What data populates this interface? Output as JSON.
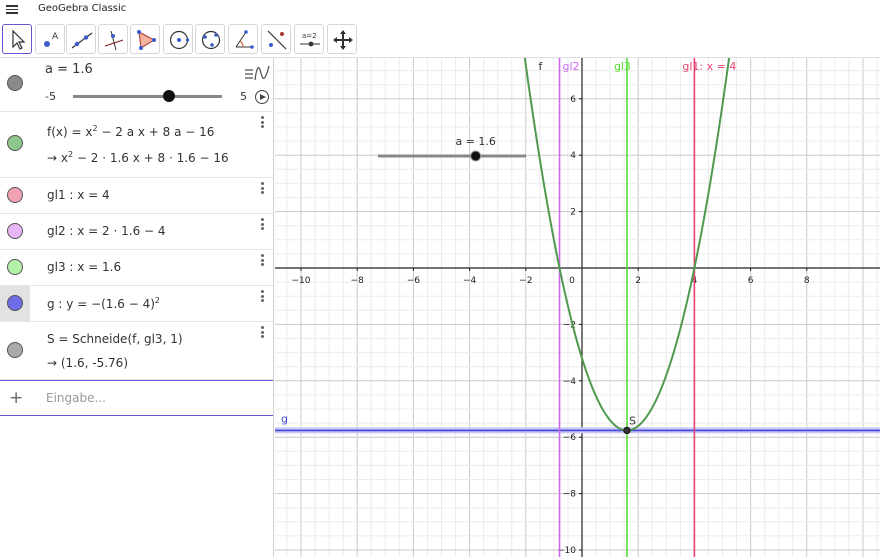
{
  "app": {
    "title": "GeoGebra Classic"
  },
  "toolbar": {
    "tools": [
      {
        "name": "move-tool-button",
        "icon": "arrow-icon",
        "active": true
      },
      {
        "name": "point-tool-button",
        "icon": "point-icon"
      },
      {
        "name": "line-tool-button",
        "icon": "line-icon"
      },
      {
        "name": "perpendicular-line-tool-button",
        "icon": "perpendicular-icon"
      },
      {
        "name": "polygon-tool-button",
        "icon": "polygon-icon"
      },
      {
        "name": "circle-tool-button",
        "icon": "circle-center-icon"
      },
      {
        "name": "circle-three-points-tool-button",
        "icon": "circle-three-points-icon"
      },
      {
        "name": "angle-tool-button",
        "icon": "angle-icon"
      },
      {
        "name": "reflect-tool-button",
        "icon": "reflect-icon"
      },
      {
        "name": "slider-tool-button",
        "icon": "slider-icon",
        "label": "a=2"
      },
      {
        "name": "move-graphics-tool-button",
        "icon": "move-graphics-icon"
      }
    ]
  },
  "algebra": {
    "slider": {
      "label": "a = 1.6",
      "min": "-5",
      "max": "5",
      "value": 1.6
    },
    "f": {
      "def": "f(x) = x",
      "def_exp": "2",
      "def_rest": " − 2 a x + 8 a − 16",
      "arrow": "→",
      "val": "  x",
      "val_exp": "2",
      "val_rest": " − 2 · 1.6 x + 8 · 1.6 − 16",
      "color": "#4f9a4f"
    },
    "gl1": {
      "def": "gl1 : x = 4",
      "color": "#f0728a"
    },
    "gl2": {
      "def": "gl2 : x = 2 · 1.6 − 4",
      "color": "#d98ef2"
    },
    "gl3": {
      "def": "gl3 : x = 1.6",
      "color": "#8ae67a"
    },
    "g": {
      "def": "g : y = −(1.6 − 4)",
      "def_exp": "2",
      "color": "#6666dd"
    },
    "S": {
      "def": "S = Schneide(f, gl3, 1)",
      "arrow": "→",
      "val": "  (1.6, -5.76)",
      "color": "#999999"
    },
    "input": {
      "placeholder": "Eingabe..."
    }
  },
  "graphics": {
    "x_ticks": [
      "−10",
      "−8",
      "−6",
      "−4",
      "−2",
      "0",
      "2",
      "4",
      "6",
      "8"
    ],
    "y_ticks": [
      "6",
      "4",
      "2",
      "−2",
      "−4",
      "−6",
      "−8",
      "−10"
    ],
    "labels": {
      "f": "f",
      "gl2": "gl2",
      "gl3": "gl3",
      "gl1": "gl1: x = 4",
      "g": "g",
      "S": "S",
      "slider": "a = 1.6"
    },
    "colors": {
      "f": "#4f9a4f",
      "gl1": "#e8426f",
      "gl2": "#cc66ee",
      "gl3": "#55dd33",
      "g": "#4444dd"
    }
  }
}
